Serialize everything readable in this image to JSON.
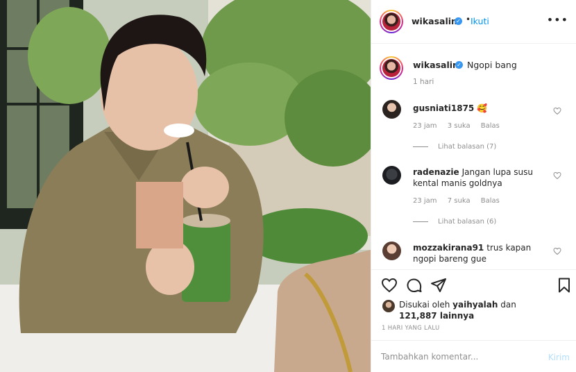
{
  "post": {
    "author": "wikasalim",
    "follow_label": "Ikuti",
    "dot": "•",
    "more_label": "•••"
  },
  "caption": {
    "username": "wikasalim",
    "text": "Ngopi bang",
    "time": "1 hari"
  },
  "comments": [
    {
      "username": "gusniati1875",
      "text": "🥰",
      "time": "23 jam",
      "likes": "3 suka",
      "reply": "Balas",
      "view_replies": "Lihat balasan (7)"
    },
    {
      "username": "radenazie",
      "text": "Jangan lupa susu kental manis goldnya",
      "time": "23 jam",
      "likes": "7 suka",
      "reply": "Balas",
      "view_replies": "Lihat balasan (6)"
    },
    {
      "username": "mozzakirana91",
      "text": "trus kapan ngopi bareng gue"
    }
  ],
  "likes": {
    "prefix": "Disukai oleh",
    "liked_by": "yaihyalah",
    "connector": "dan",
    "count": "121,887 lainnya"
  },
  "posted": "1 HARI YANG LALU",
  "add_comment": {
    "placeholder": "Tambahkan komentar...",
    "send_label": "Kirim"
  },
  "colors": {
    "link": "#0095f6",
    "verified": "#3897f0",
    "muted": "#8e8e8e",
    "send_disabled": "#b2dffc"
  },
  "icons": [
    "heart-icon",
    "comment-icon",
    "share-icon",
    "bookmark-icon",
    "verified-icon",
    "more-icon"
  ]
}
